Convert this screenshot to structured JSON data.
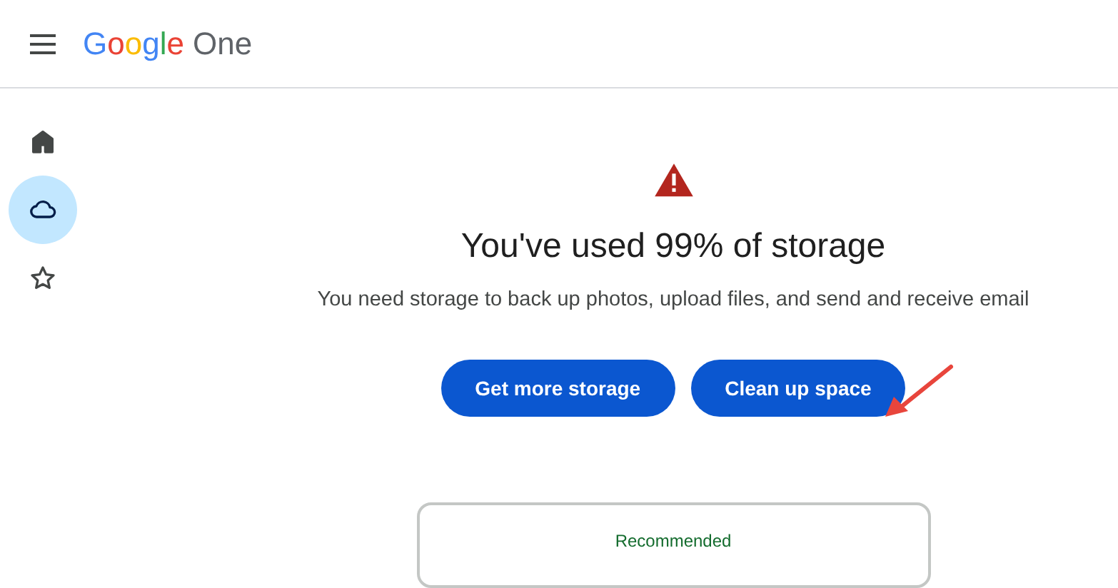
{
  "header": {
    "logo_brand": "Google",
    "logo_product": "One"
  },
  "sidebar": {
    "items": [
      {
        "kind": "home",
        "selected": false
      },
      {
        "kind": "cloud",
        "selected": true
      },
      {
        "kind": "star",
        "selected": false
      }
    ]
  },
  "main": {
    "title": "You've used 99% of storage",
    "message": "You need storage to back up photos, upload files, and send and receive email",
    "buttons": [
      "Get more storage",
      "Clean up space"
    ],
    "card": {
      "badge": "Recommended"
    }
  }
}
